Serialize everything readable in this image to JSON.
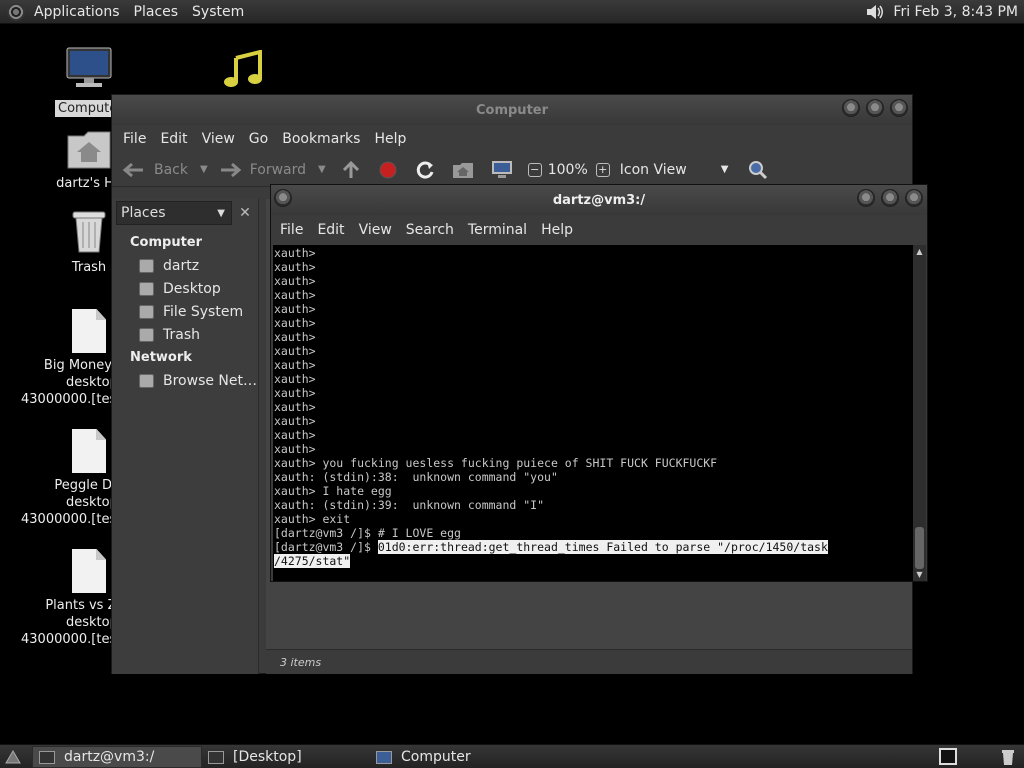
{
  "top_panel": {
    "menus": [
      "Applications",
      "Places",
      "System"
    ],
    "clock": "Fri Feb  3,  8:43 PM"
  },
  "desktop_icons": {
    "computer": "Computer",
    "home": "dartz's Ho",
    "trash": "Trash",
    "file1": [
      "Big Money De",
      "desktop.i",
      "43000000.[tes"
    ],
    "file2": [
      "Peggle Del",
      "desktop.i",
      "43000000.[tes"
    ],
    "file3": [
      "Plants vs Zon",
      "desktop.i",
      "43000000.[tes"
    ]
  },
  "fm_window": {
    "title": "Computer",
    "menu": [
      "File",
      "Edit",
      "View",
      "Go",
      "Bookmarks",
      "Help"
    ],
    "toolbar": {
      "back": "Back",
      "forward": "Forward",
      "zoom": "100%",
      "view_mode": "Icon View"
    },
    "sidebar": {
      "header": "Places",
      "close": "✕",
      "sections": {
        "computer": "Computer",
        "network": "Network"
      },
      "computer_items": [
        "dartz",
        "Desktop",
        "File System",
        "Trash"
      ],
      "network_items": [
        "Browse Net…"
      ]
    },
    "status": "3 items"
  },
  "term_window": {
    "title": "dartz@vm3:/",
    "menu": [
      "File",
      "Edit",
      "View",
      "Search",
      "Terminal",
      "Help"
    ],
    "lines": [
      "xauth>",
      "xauth>",
      "xauth>",
      "xauth>",
      "xauth>",
      "xauth>",
      "xauth>",
      "xauth>",
      "xauth>",
      "xauth>",
      "xauth>",
      "xauth>",
      "xauth>",
      "xauth>",
      "xauth>",
      "xauth> you fucking uesless fucking puiece of SHIT FUCK FUCKFUCKF",
      "xauth: (stdin):38:  unknown command \"you\"",
      "xauth> I hate egg",
      "xauth: (stdin):39:  unknown command \"I\"",
      "xauth> exit",
      "[dartz@vm3 /]$ # I LOVE egg"
    ],
    "prompt": "[dartz@vm3 /]$ ",
    "highlight_1": "01d0:err:thread:get_thread_times Failed to parse \"/proc/1450/task",
    "highlight_2": "/4275/stat\""
  },
  "bottom_panel": {
    "tasks": [
      "dartz@vm3:/",
      "[Desktop]",
      "Computer"
    ]
  }
}
